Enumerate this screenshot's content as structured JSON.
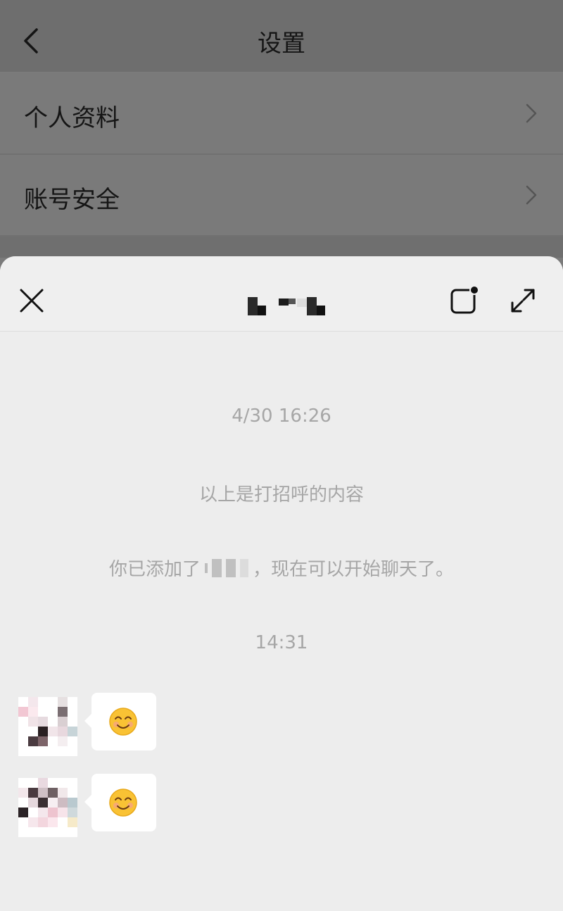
{
  "background_page": {
    "title": "设置",
    "menu_items": [
      {
        "label": "个人资料"
      },
      {
        "label": "账号安全"
      }
    ]
  },
  "chat": {
    "contact_name_redacted": true,
    "messages_area": {
      "timestamp_1": "4/30 16:26",
      "system_greeting": "以上是打招呼的内容",
      "system_added_prefix": "你已添加了",
      "system_added_suffix": "，现在可以开始聊天了。",
      "timestamp_2": "14:31",
      "messages": [
        {
          "emoji": "smiling-face-emoji"
        },
        {
          "emoji": "smiling-face-emoji"
        }
      ]
    }
  },
  "colors": {
    "overlay_bg": "#7b7b7b",
    "sheet_bg": "#ededed",
    "system_text": "#a6a6a6",
    "bubble_bg": "#ffffff"
  }
}
